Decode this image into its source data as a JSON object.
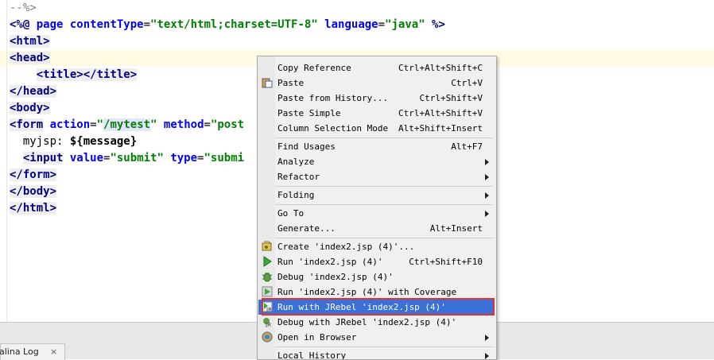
{
  "editor": {
    "lines": [
      {
        "comment": "--%>"
      },
      {
        "directive_open": "<%@ ",
        "kw_page": "page ",
        "attr_ct": "contentType",
        "eq1": "=",
        "val_ct": "\"text/html;charset=UTF-8\"",
        "attr_lang": " language",
        "eq2": "=",
        "val_lang": "\"java\"",
        "close": " %>"
      },
      {
        "tag": "<html>"
      },
      {
        "tag": "<head>"
      },
      {
        "indent": "    ",
        "tag_open": "<title>",
        "tag_close": "</title>"
      },
      {
        "tag": "</head>"
      },
      {
        "tag": "<body>"
      },
      {
        "tag_open": "<form",
        "attr_action": " action",
        "eq1": "=",
        "val_action_q1": "\"",
        "val_action": "/mytest",
        "val_action_q2": "\"",
        "attr_method": " method",
        "eq2": "=",
        "val_method": "\"post"
      },
      {
        "indent": "  ",
        "text": "myjsp: ",
        "el": "${message}"
      },
      {
        "indent": "  ",
        "tag_open": "<input",
        "attr_value": " value",
        "eq1": "=",
        "val_value": "\"submit\"",
        "attr_type": " type",
        "eq2": "=",
        "val_type": "\"submi"
      },
      {
        "tag": "</form>"
      },
      {
        "tag": "</body>"
      },
      {
        "tag": "</html>"
      }
    ]
  },
  "bottom_panel": {
    "tab_label": "alina Log",
    "close_glyph": "×"
  },
  "context_menu": {
    "items": [
      {
        "label": "Copy Reference",
        "shortcut": "Ctrl+Alt+Shift+C"
      },
      {
        "label": "Paste",
        "shortcut": "Ctrl+V",
        "icon": "paste-icon"
      },
      {
        "label": "Paste from History...",
        "shortcut": "Ctrl+Shift+V"
      },
      {
        "label": "Paste Simple",
        "shortcut": "Ctrl+Alt+Shift+V"
      },
      {
        "label": "Column Selection Mode",
        "shortcut": "Alt+Shift+Insert"
      },
      {
        "label": "Find Usages",
        "shortcut": "Alt+F7"
      },
      {
        "label": "Analyze",
        "submenu": true
      },
      {
        "label": "Refactor",
        "submenu": true
      },
      {
        "label": "Folding",
        "submenu": true
      },
      {
        "label": "Go To",
        "submenu": true
      },
      {
        "label": "Generate...",
        "shortcut": "Alt+Insert"
      },
      {
        "label": "Create 'index2.jsp (4)'...",
        "icon": "create-config-icon"
      },
      {
        "label": "Run 'index2.jsp (4)'",
        "shortcut": "Ctrl+Shift+F10",
        "icon": "run-icon"
      },
      {
        "label": "Debug 'index2.jsp (4)'",
        "icon": "debug-icon"
      },
      {
        "label": "Run 'index2.jsp (4)' with Coverage",
        "icon": "coverage-icon"
      },
      {
        "label": "Run with JRebel 'index2.jsp (4)'",
        "icon": "jrebel-run-icon",
        "selected": true
      },
      {
        "label": "Debug with JRebel 'index2.jsp (4)'",
        "icon": "jrebel-debug-icon"
      },
      {
        "label": "Open in Browser",
        "submenu": true,
        "icon": "browser-icon"
      },
      {
        "label": "Local History",
        "submenu": true
      }
    ]
  },
  "colors": {
    "selection": "#3b70d6",
    "highlight_box": "#e23333"
  }
}
